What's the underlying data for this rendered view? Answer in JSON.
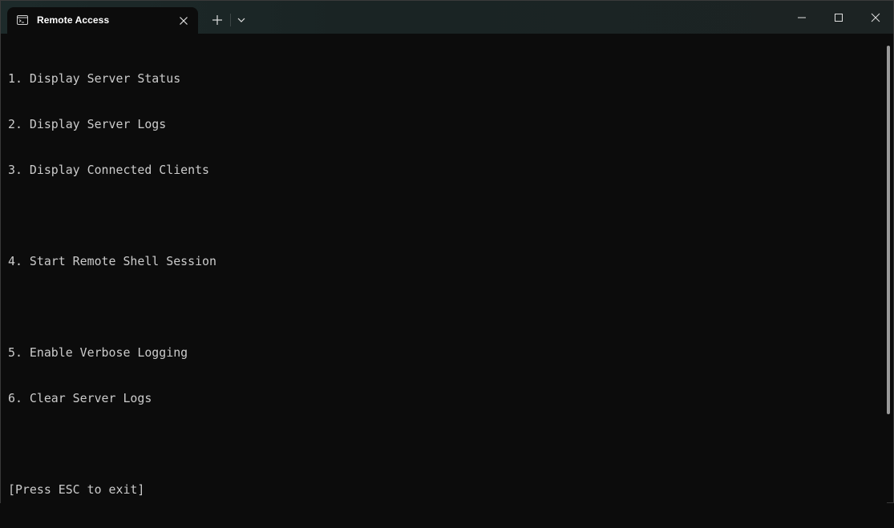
{
  "window": {
    "tab_title": "Remote Access",
    "tab_icon": "terminal-icon"
  },
  "controls": {
    "new_tab_icon": "plus-icon",
    "dropdown_icon": "chevron-down-icon",
    "minimize_icon": "minimize-icon",
    "maximize_icon": "maximize-icon",
    "close_icon": "close-icon"
  },
  "terminal": {
    "lines": [
      "1. Display Server Status",
      "2. Display Server Logs",
      "3. Display Connected Clients",
      "",
      "4. Start Remote Shell Session",
      "",
      "5. Enable Verbose Logging",
      "6. Clear Server Logs",
      "",
      "[Press ESC to exit]"
    ],
    "foreground": "#cccccc",
    "background": "#0c0c0c"
  }
}
